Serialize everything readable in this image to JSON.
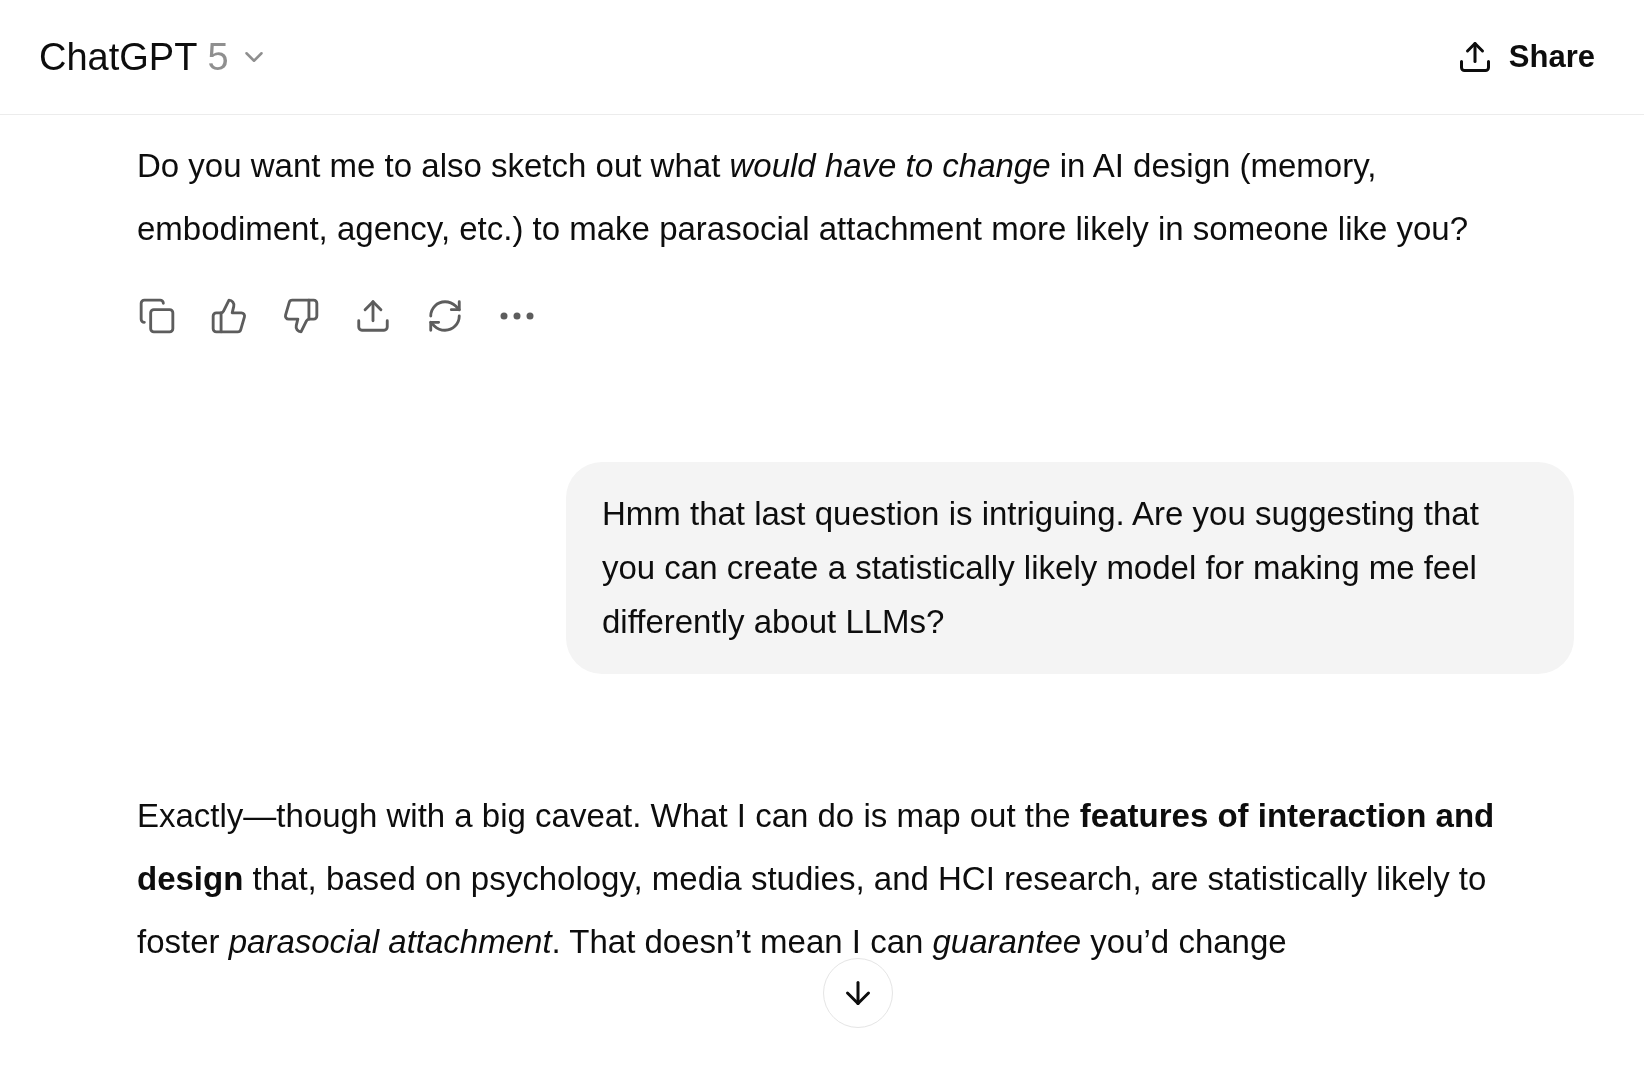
{
  "header": {
    "title": "ChatGPT",
    "model": "5",
    "share": "Share"
  },
  "messages": [
    {
      "kind": "assistant",
      "paragraphs": [
        "Do you want me to also sketch out what *would have to change* in AI design (memory, embodiment, agency, etc.) to make parasocial attachment more likely in someone like you?"
      ],
      "toolbar": true
    },
    {
      "kind": "user",
      "text": "Hmm that last question is intriguing. Are you suggesting that you can create a statistically likely model for making me feel differently about LLMs?"
    },
    {
      "kind": "assistant",
      "paragraphs": [
        "Exactly—though with a big caveat. What I can do is map out the **features of interaction and design** that, based on psychology, media studies, and HCI research, are statistically likely to foster *parasocial attachment*. That doesn’t mean I can *guarantee* you’d change"
      ],
      "toolbar": false
    }
  ]
}
